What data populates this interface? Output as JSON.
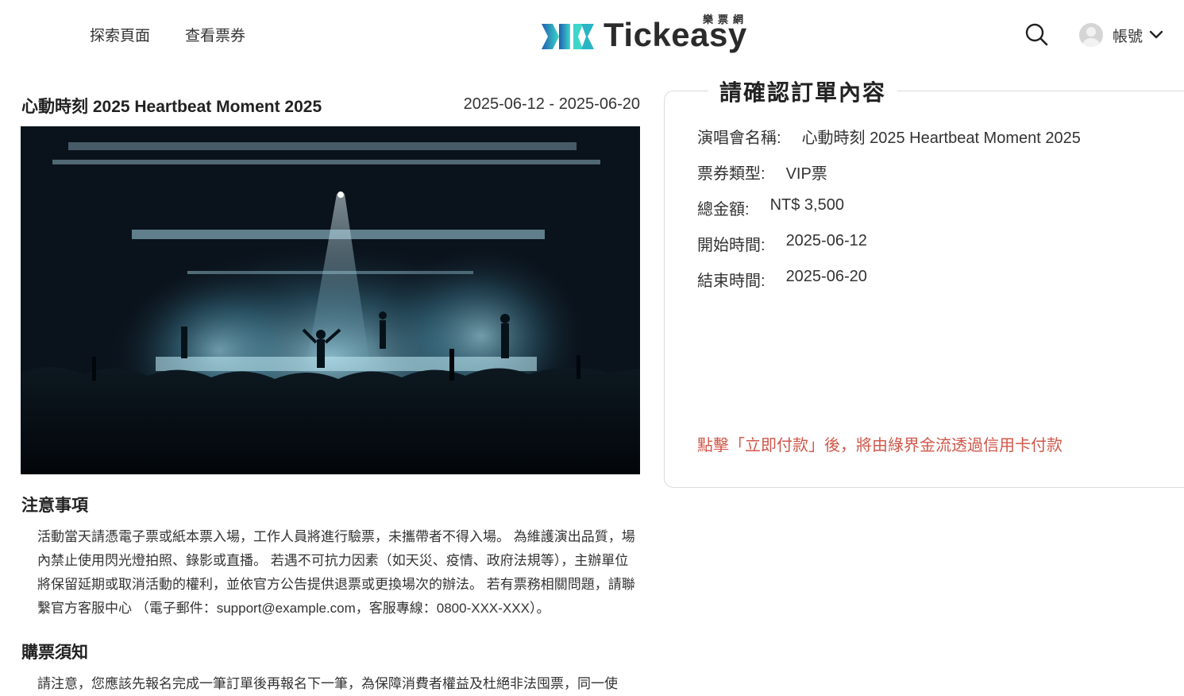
{
  "header": {
    "nav": [
      {
        "label": "探索頁面"
      },
      {
        "label": "查看票券"
      }
    ],
    "logo": {
      "text": "Tickeasy",
      "subtitle": "樂票網"
    },
    "search_icon": "search-icon",
    "account_label": "帳號"
  },
  "event": {
    "title": "心動時刻 2025 Heartbeat Moment 2025",
    "dates": "2025-06-12 - 2025-06-20"
  },
  "notice": {
    "title": "注意事項",
    "body": "活動當天請憑電子票或紙本票入場，工作人員將進行驗票，未攜帶者不得入場。 為維護演出品質，場內禁止使用閃光燈拍照、錄影或直播。 若遇不可抗力因素（如天災、疫情、政府法規等），主辦單位將保留延期或取消活動的權利，並依官方公告提供退票或更換場次的辦法。 若有票務相關問題，請聯繫官方客服中心 （電子郵件：support@example.com，客服專線：0800-XXX-XXX）。"
  },
  "purchase": {
    "title": "購票須知",
    "body": "請注意，您應該先報名完成一筆訂單後再報名下一筆，為保障消費者權益及杜絕非法囤票，同一使"
  },
  "order": {
    "title": "請確認訂單內容",
    "name_label": "演唱會名稱:",
    "name_value": "心動時刻 2025 Heartbeat Moment 2025",
    "type_label": "票券類型:",
    "type_value": "VIP票",
    "total_label": "總金額:",
    "total_value": "NT$ 3,500",
    "start_label": "開始時間:",
    "start_value": "2025-06-12",
    "end_label": "結束時間:",
    "end_value": "2025-06-20",
    "payment_note": "點擊「立即付款」後，將由綠界金流透過信用卡付款"
  },
  "colors": {
    "accent_note": "#d0574a",
    "logo_gradient_start": "#1e5fb0",
    "logo_gradient_end": "#3dd6c8"
  }
}
